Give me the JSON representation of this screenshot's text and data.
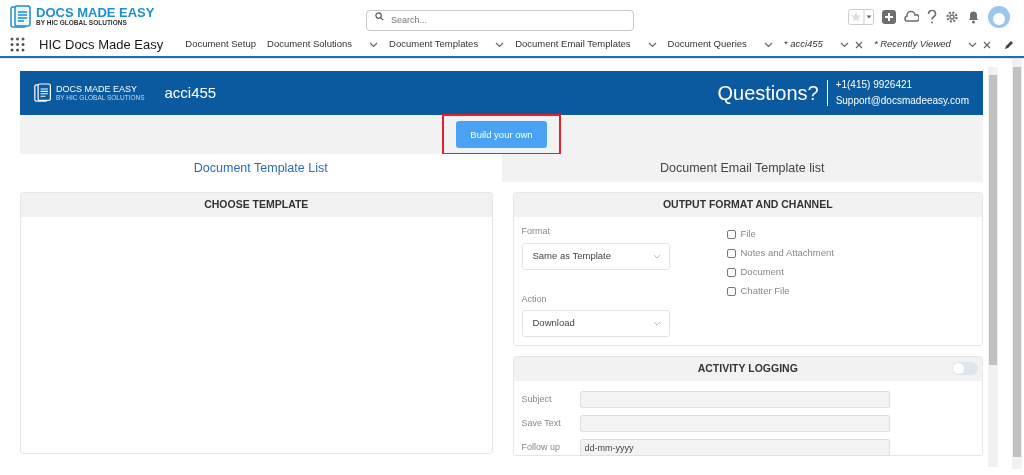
{
  "header": {
    "logo": {
      "title": "DOCS MADE EASY",
      "subtitle": "BY HIC GLOBAL SOLUTIONS"
    },
    "search": {
      "placeholder": "Search..."
    }
  },
  "nav": {
    "app_name": "HIC Docs Made Easy",
    "items": [
      {
        "label": "Document Setup",
        "kind": "link"
      },
      {
        "label": "Document Solutions",
        "kind": "menu"
      },
      {
        "label": "Document Templates",
        "kind": "menu"
      },
      {
        "label": "Document Email Templates",
        "kind": "menu"
      },
      {
        "label": "Document Queries",
        "kind": "menu"
      },
      {
        "label": "* acci455",
        "kind": "workspace"
      },
      {
        "label": "* Recently Viewed",
        "kind": "workspace"
      }
    ]
  },
  "banner": {
    "logo": {
      "title": "DOCS MADE EASY",
      "subtitle": "BY HIC GLOBAL SOLUTIONS"
    },
    "record": "acci455",
    "questions": "Questions?",
    "phone": "+1(415) 9926421",
    "email": "Support@docsmadeeasy.com"
  },
  "build_button": {
    "label": "Build your own",
    "highlighted": true
  },
  "tabs": [
    {
      "label": "Document Template List",
      "selected": true
    },
    {
      "label": "Document Email Template list",
      "selected": false
    }
  ],
  "choose_template": {
    "title": "CHOOSE TEMPLATE"
  },
  "output": {
    "title": "OUTPUT FORMAT AND CHANNEL",
    "format": {
      "label": "Format",
      "value": "Same as Template"
    },
    "action": {
      "label": "Action",
      "value": "Download"
    },
    "channels": [
      {
        "label": "File",
        "checked": false
      },
      {
        "label": "Notes and Attachment",
        "checked": false
      },
      {
        "label": "Document",
        "checked": false
      },
      {
        "label": "Chatter File",
        "checked": false
      }
    ]
  },
  "activity": {
    "title": "ACTIVITY LOGGING",
    "on": false,
    "fields": [
      {
        "label": "Subject"
      },
      {
        "label": "Save Text"
      },
      {
        "label": "Follow up",
        "placeholder": "dd-mm-yyyy"
      }
    ]
  }
}
